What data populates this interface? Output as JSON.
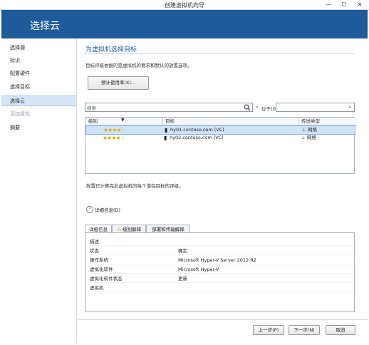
{
  "window": {
    "title": "创建虚拟机向导",
    "minimize": "—",
    "maximize": "☐",
    "close": "✕"
  },
  "header": {
    "title": "选择云"
  },
  "sidebar": {
    "items": [
      {
        "label": "选择源",
        "state": "normal"
      },
      {
        "label": "标识",
        "state": "normal"
      },
      {
        "label": "配置硬件",
        "state": "normal"
      },
      {
        "label": "选择目标",
        "state": "normal"
      },
      {
        "label": "选择云",
        "state": "active"
      },
      {
        "label": "添加属性",
        "state": "disabled"
      },
      {
        "label": "摘要",
        "state": "normal"
      }
    ]
  },
  "main": {
    "title": "为虚拟机选择目标",
    "description": "目标评级依据的是虚拟机的要求和默认的放置选项。",
    "estimate_button": "预计使用率(X)...",
    "search": {
      "placeholder": "搜索",
      "in_label": "位于(I)",
      "in_value": ""
    },
    "grid": {
      "columns": [
        "级别",
        "目标",
        "传送类型"
      ],
      "rows": [
        {
          "rating": 4,
          "max_rating": 5,
          "target": "hy01.contoso.com (VC)",
          "transfer": "网络",
          "selected": true
        },
        {
          "rating": 4,
          "max_rating": 5,
          "target": "hy02.contoso.com (VC)",
          "transfer": "网络",
          "selected": false
        }
      ]
    },
    "status_text": "放置已计算完此虚拟机的每个潜在目标的评级。",
    "details_toggle": "详细信息(D)",
    "tabs": [
      "详细信息",
      "级别解释",
      "部署和传输解释"
    ],
    "details": {
      "heading": "描述",
      "rows": [
        {
          "key": "状态",
          "value": "确定"
        },
        {
          "key": "操作系统",
          "value": "Microsoft Hyper-V Server 2012 R2"
        },
        {
          "key": "虚拟化软件",
          "value": "Microsoft Hyper-V"
        },
        {
          "key": "虚拟化软件状态",
          "value": "更新"
        },
        {
          "key": "虚拟机",
          "value": ""
        }
      ]
    }
  },
  "footer": {
    "prev": "上一步(P)",
    "next": "下一步(N)",
    "cancel": "取消"
  },
  "colors": {
    "header_bg": "#1f5b9a",
    "accent": "#1f5b9a",
    "selection": "#cfe3f8"
  },
  "icons": {
    "star": "star-icon",
    "server": "server-icon",
    "network": "network-icon",
    "warning": "warning-icon"
  }
}
